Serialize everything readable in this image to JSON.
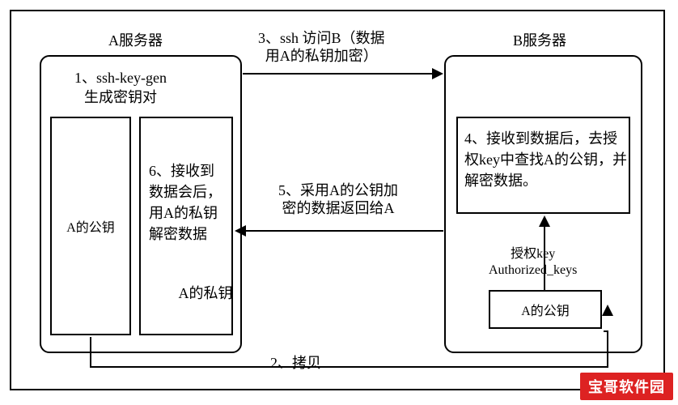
{
  "serverA": {
    "title": "A服务器",
    "step1": "1、ssh-key-gen\n生成密钥对",
    "pubkey": "A的公钥",
    "step6": "6、接收到\n数据会后，\n用A的私钥\n解密数据",
    "privkey": "A的私钥"
  },
  "serverB": {
    "title": "B服务器",
    "step4": "4、接收到数据后，去授\n权key中查找A的公钥，并\n解密数据。",
    "authkeys": "授权key\nAuthorized_keys",
    "pubkeyA": "A的公钥"
  },
  "arrows": {
    "step3": "3、ssh 访问B（数据\n用A的私钥加密）",
    "step5": "5、采用A的公钥加\n密的数据返回给A",
    "step2": "2、拷贝"
  },
  "watermark": "宝哥软件园"
}
